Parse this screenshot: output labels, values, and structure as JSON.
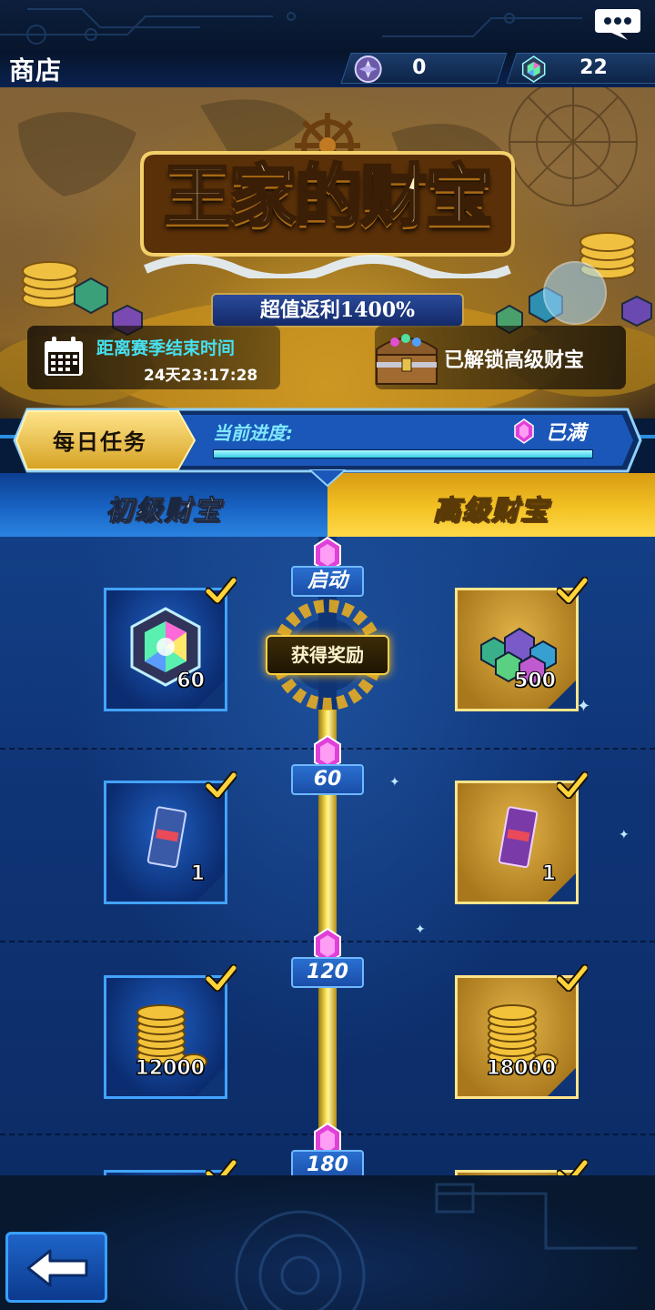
{
  "header": {
    "title": "商店",
    "currencies": [
      {
        "icon": "purple-orb-icon",
        "value": "0"
      },
      {
        "icon": "rainbow-gem-icon",
        "value": "22"
      }
    ],
    "chat_icon": "chat-bubble-icon"
  },
  "banner": {
    "logo_title": "王家的财宝",
    "logo_subtitle": "超值返利1400%",
    "season_label": "距离赛季结束时间",
    "season_time": "24天23:17:28",
    "unlock_label": "已解锁高级财宝"
  },
  "daily_task": {
    "label": "每日任务",
    "progress_label": "当前进度:",
    "progress_fraction": 1.0,
    "status": "已满"
  },
  "tabs": {
    "basic": "初级财宝",
    "premium": "高级财宝",
    "selected": "premium"
  },
  "track": {
    "claim_button": "获得奖励",
    "tiers": [
      {
        "node": "启动",
        "basic": {
          "item": "rainbow-gem",
          "qty": "60",
          "claimed": true
        },
        "premium": {
          "item": "gem-pile",
          "qty": "500",
          "claimed": true
        }
      },
      {
        "node": "60",
        "basic": {
          "item": "card-pack",
          "qty": "1",
          "claimed": true
        },
        "premium": {
          "item": "card-pack",
          "qty": "1",
          "claimed": true
        }
      },
      {
        "node": "120",
        "basic": {
          "item": "gold-coins",
          "qty": "12000",
          "claimed": true
        },
        "premium": {
          "item": "gold-coins",
          "qty": "18000",
          "claimed": true
        }
      },
      {
        "node": "180",
        "basic": {
          "item": "unknown",
          "qty": "",
          "claimed": true
        },
        "premium": {
          "item": "unknown",
          "qty": "",
          "claimed": true
        }
      }
    ]
  },
  "footer": {
    "back_icon": "back-arrow-icon"
  },
  "colors": {
    "basic_accent": "#43a3ff",
    "premium_accent": "#f3c224",
    "node_gem": "#e040d8",
    "check": "#ffd43a"
  }
}
